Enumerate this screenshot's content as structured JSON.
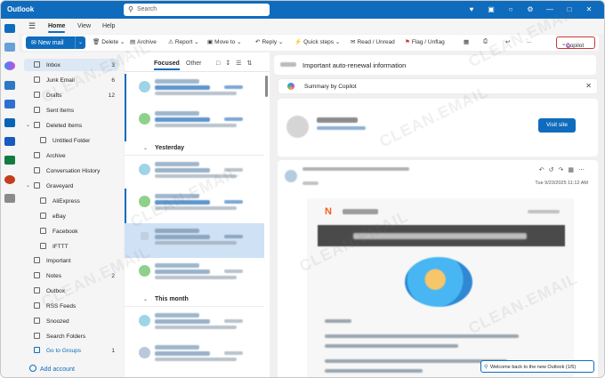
{
  "app": {
    "title": "Outlook"
  },
  "search": {
    "placeholder": "Search"
  },
  "titlebar_icons": [
    "skype-icon",
    "teams-icon",
    "bell-icon",
    "gear-icon",
    "minimize-icon",
    "maximize-icon",
    "close-icon"
  ],
  "tabs": {
    "home": "Home",
    "view": "View",
    "help": "Help"
  },
  "ribbon": {
    "new_mail": "New mail",
    "delete": "Delete",
    "archive": "Archive",
    "report": "Report",
    "move_to": "Move to",
    "reply": "Reply",
    "quick_steps": "Quick steps",
    "read_unread": "Read / Unread",
    "flag_unflag": "Flag / Unflag",
    "more": "...",
    "copilot": "Copilot"
  },
  "folders": {
    "items": [
      {
        "label": "Inbox",
        "count": "3"
      },
      {
        "label": "Junk Email",
        "count": "6"
      },
      {
        "label": "Drafts",
        "count": "12"
      },
      {
        "label": "Sent Items",
        "count": ""
      },
      {
        "label": "Deleted Items",
        "count": ""
      },
      {
        "label": "Untitled Folder",
        "count": ""
      },
      {
        "label": "Archive",
        "count": ""
      },
      {
        "label": "Conversation History",
        "count": ""
      },
      {
        "label": "Graveyard",
        "count": ""
      },
      {
        "label": "AliExpress",
        "count": ""
      },
      {
        "label": "eBay",
        "count": ""
      },
      {
        "label": "Facebook",
        "count": ""
      },
      {
        "label": "IFTTT",
        "count": ""
      },
      {
        "label": "Important",
        "count": ""
      },
      {
        "label": "Notes",
        "count": "2"
      },
      {
        "label": "Outbox",
        "count": ""
      },
      {
        "label": "RSS Feeds",
        "count": ""
      },
      {
        "label": "Snoozed",
        "count": ""
      },
      {
        "label": "Search Folders",
        "count": ""
      },
      {
        "label": "Go to Groups",
        "count": "1"
      }
    ],
    "add_account": "Add account"
  },
  "message_list": {
    "focused": "Focused",
    "other": "Other",
    "groups": {
      "yesterday": "Yesterday",
      "this_month": "This month"
    }
  },
  "reading": {
    "subject": "Important auto-renewal information",
    "copilot_summary": "Summary by Copilot",
    "visit_site": "Visit site",
    "date": "Tue 9/23/2025 11:12 AM"
  },
  "toast": {
    "text": "Welcome back to the new Outlook (1/5)"
  },
  "watermark": "CLEAN.EMAIL",
  "colors": {
    "accent": "#0f6cbd",
    "namecheap": "#ff5b1f"
  }
}
